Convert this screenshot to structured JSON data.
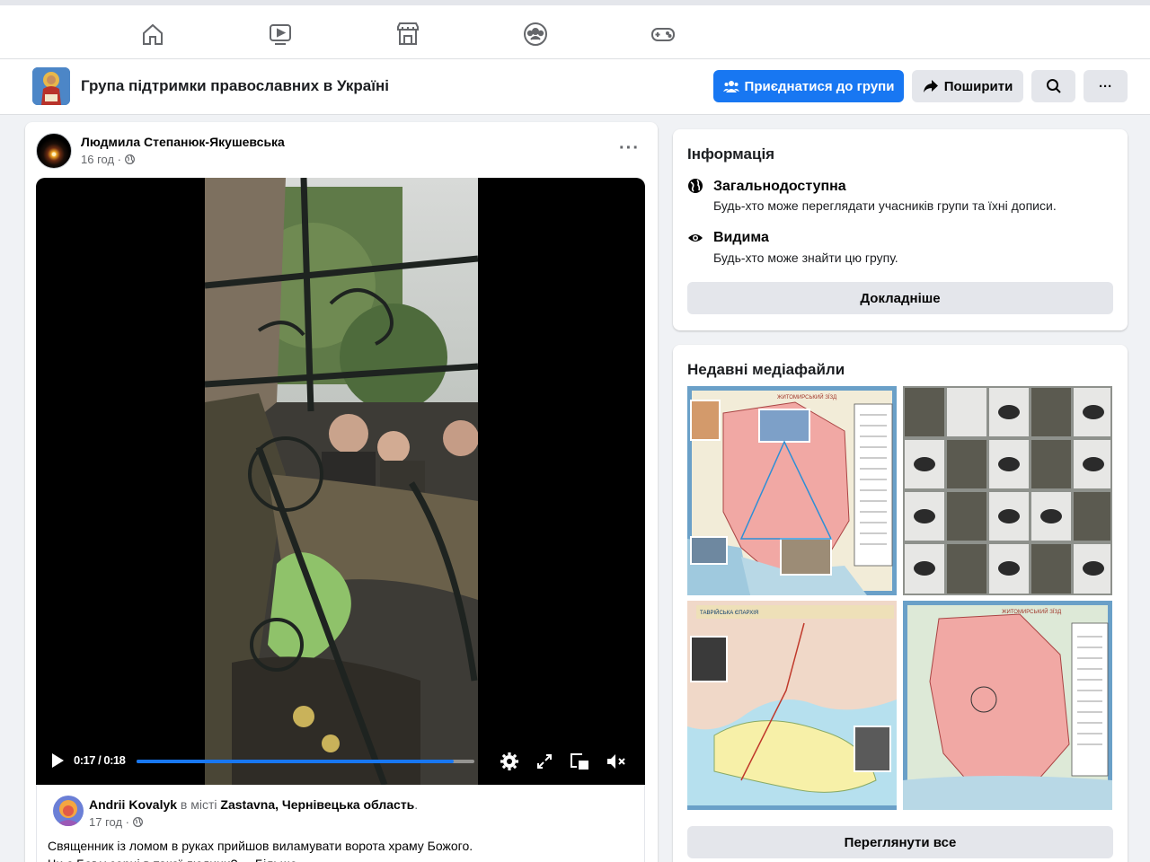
{
  "nav": {
    "items": [
      {
        "name": "home-icon"
      },
      {
        "name": "video-icon"
      },
      {
        "name": "marketplace-icon"
      },
      {
        "name": "groups-icon"
      },
      {
        "name": "gaming-icon"
      }
    ]
  },
  "group": {
    "title": "Група підтримки православних в Україні",
    "join_label": "Приєднатися до групи",
    "share_label": "Поширити",
    "more_label": "···"
  },
  "post": {
    "author": "Людмила Степанюк-Якушевська",
    "time": "16 год · ",
    "menu": "···",
    "video": {
      "time": "0:17 / 0:18",
      "progress": 0.94
    },
    "shared": {
      "author": "Andrii Kovalyk",
      "in_city": " в місті ",
      "place": "Zastavna, Чернівецька область",
      "period": ".",
      "time": "17 год · ",
      "text_line1": "Священник із ломом в руках прийшов виламувати ворота храму Божого.",
      "text_line2": "Чи є Бог у серці в такої людини? ... Більше"
    }
  },
  "info": {
    "title": "Інформація",
    "public_title": "Загальнодоступна",
    "public_desc": "Будь-хто може переглядати учасників групи та їхні дописи.",
    "visible_title": "Видима",
    "visible_desc": "Будь-хто може знайти цю групу.",
    "more_button": "Докладніше"
  },
  "media": {
    "title": "Недавні медіафайли",
    "view_all": "Переглянути все"
  },
  "colors": {
    "accent": "#1877f2",
    "page_bg": "#f0f2f5",
    "button_gray": "#e4e6eb"
  }
}
